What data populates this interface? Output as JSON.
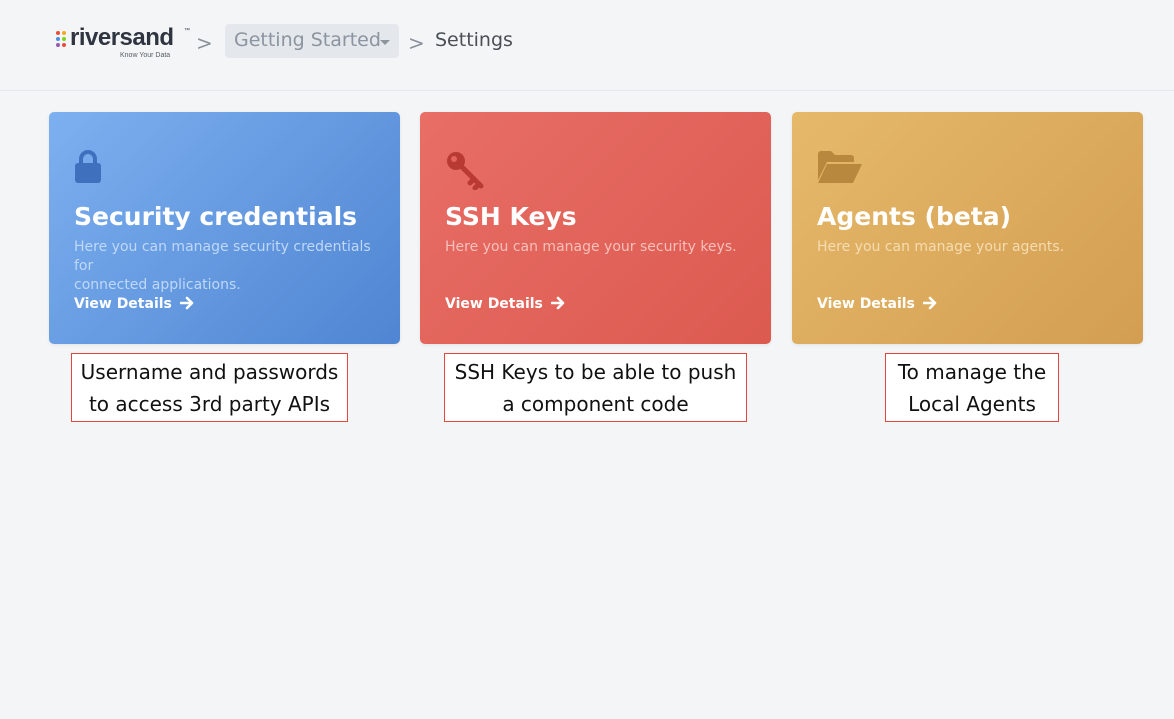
{
  "header": {
    "logo": {
      "name": "riversand",
      "tagline": "Know Your Data",
      "trademark": "™"
    },
    "breadcrumb": {
      "separator": ">",
      "dropdown_label": "Getting Started",
      "current": "Settings"
    }
  },
  "cards": [
    {
      "icon": "lock-icon",
      "title": "Security credentials",
      "description": "Here you can manage security credentials for\nconnected applications.",
      "link": "View Details",
      "color": "#5f95dd"
    },
    {
      "icon": "key-icon",
      "title": "SSH Keys",
      "description": "Here you can manage your security keys.",
      "link": "View Details",
      "color": "#e2645b"
    },
    {
      "icon": "folder-open-icon",
      "title": "Agents (beta)",
      "description": "Here you can manage your agents.",
      "link": "View Details",
      "color": "#dcab5e"
    }
  ],
  "annotations": [
    "Username and passwords\nto access 3rd party APIs",
    "SSH Keys to be able to push\na component code",
    "To manage the\nLocal Agents"
  ]
}
